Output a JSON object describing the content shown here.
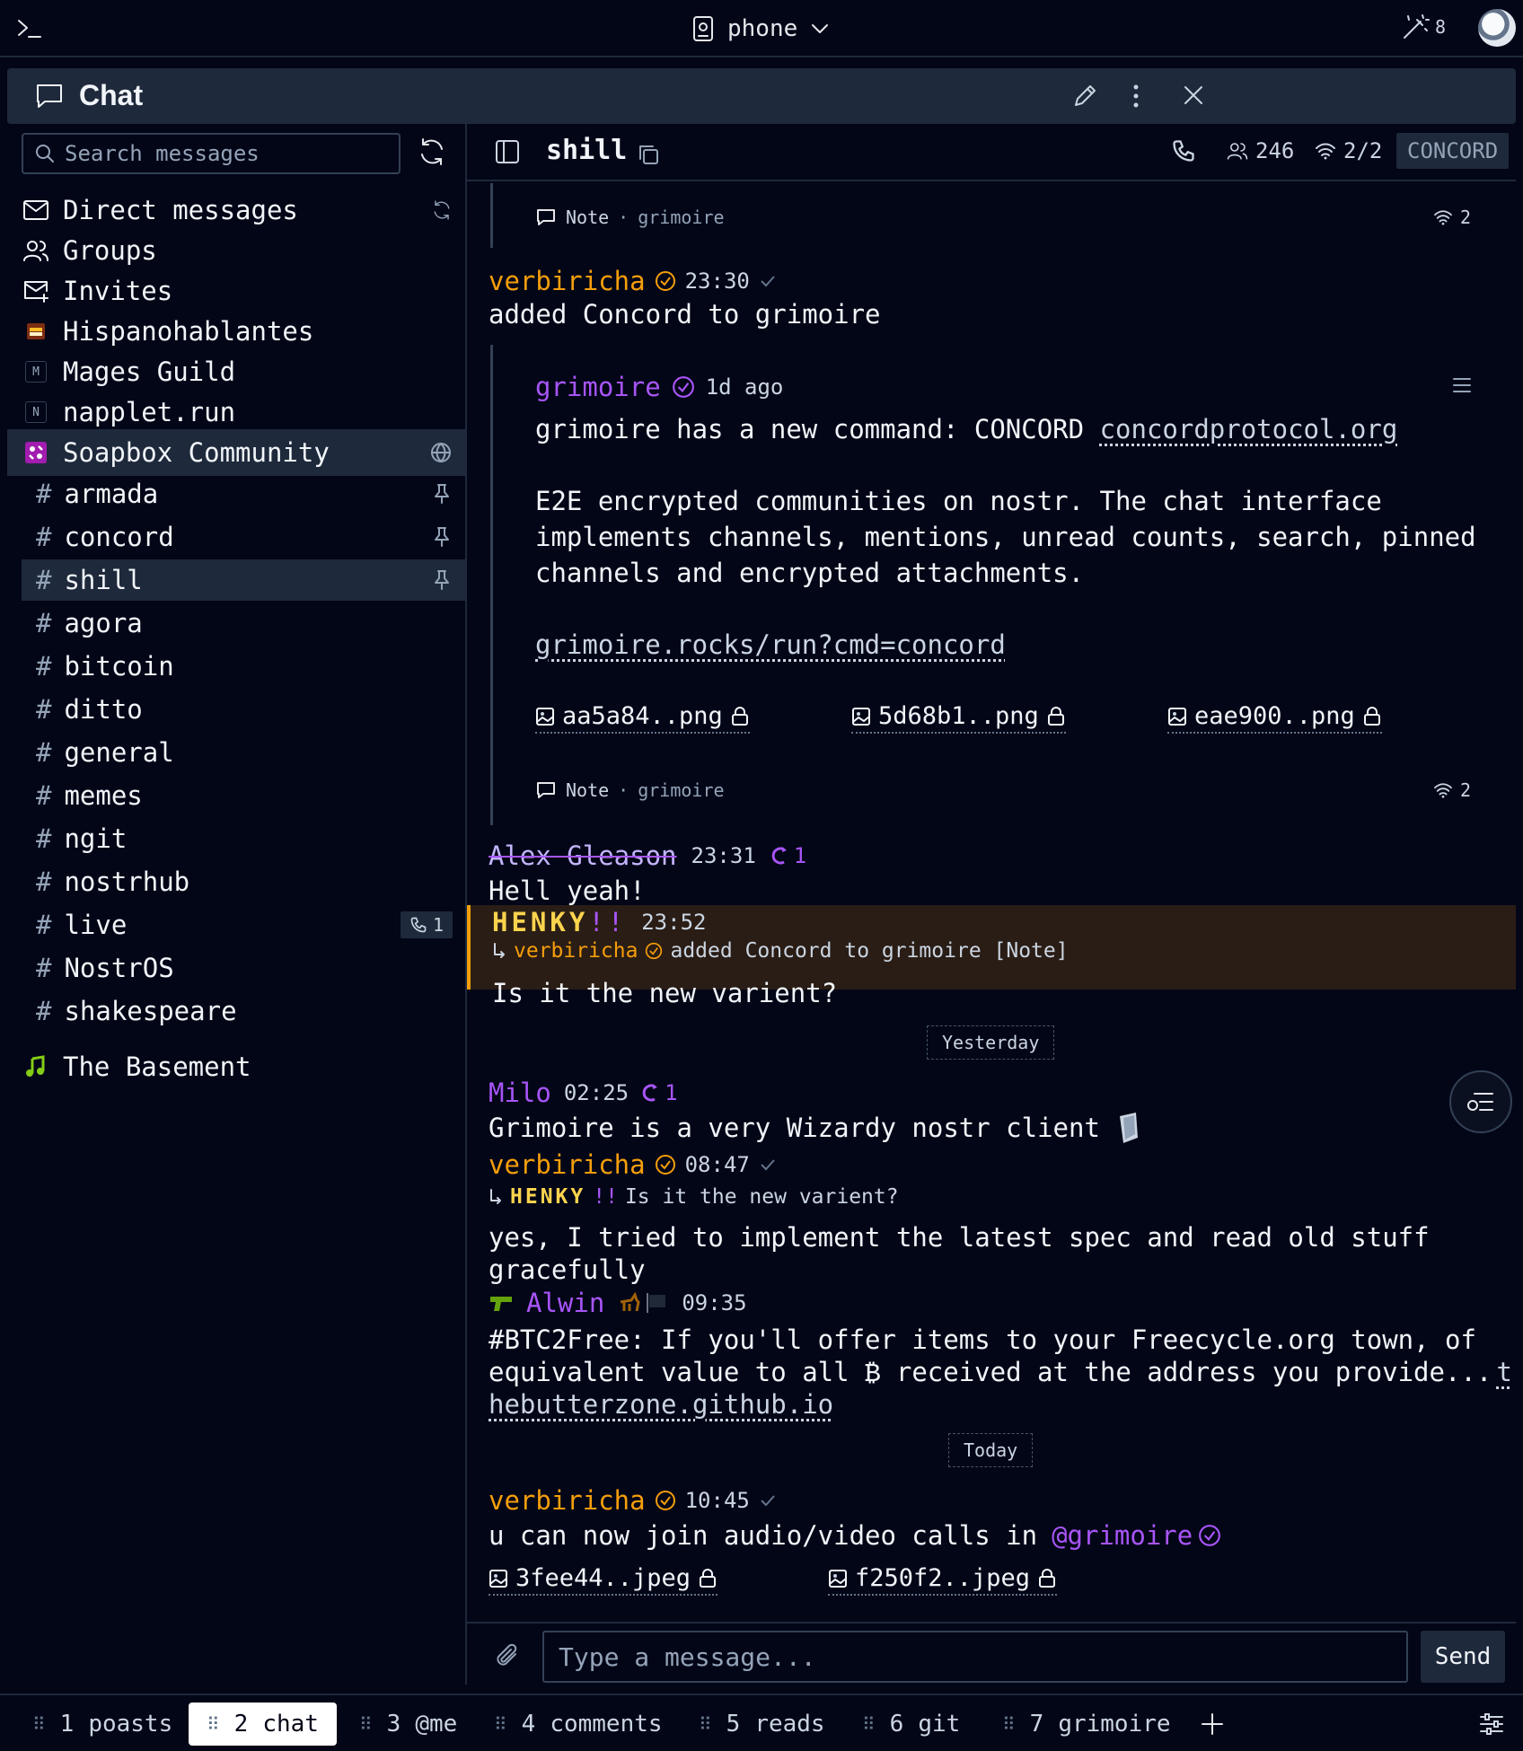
{
  "topbar": {
    "workspace": "phone",
    "wand_count": "8"
  },
  "window": {
    "title": "Chat"
  },
  "sidebar": {
    "search_placeholder": "Search messages",
    "items": [
      {
        "label": "Direct messages"
      },
      {
        "label": "Groups"
      },
      {
        "label": "Invites"
      },
      {
        "label": "Hispanohablantes"
      },
      {
        "label": "Mages Guild",
        "letter": "M"
      },
      {
        "label": "napplet.run",
        "letter": "N"
      },
      {
        "label": "Soapbox Community"
      }
    ],
    "channels": [
      "armada",
      "concord",
      "shill",
      "agora",
      "bitcoin",
      "ditto",
      "general",
      "memes",
      "ngit",
      "nostrhub",
      "live",
      "NostrOS",
      "shakespeare"
    ],
    "channel_hash": "#",
    "live_calls": "1",
    "basement": "The Basement"
  },
  "chat_header": {
    "channel": "shill",
    "members": "246",
    "relays": "2/2",
    "protocol": "CONCORD"
  },
  "messages": {
    "top_note": {
      "kind": "Note",
      "sep": "·",
      "source": "grimoire",
      "relays": "2"
    },
    "m1": {
      "author": "verbiricha",
      "time": "23:30",
      "text": "added Concord to grimoire"
    },
    "quote": {
      "author": "grimoire",
      "time": "1d ago",
      "line1": "grimoire has a new command: CONCORD",
      "line1_link": "concordprotocol.org",
      "para1": "E2E encrypted communities on nostr. The chat interface",
      "para2": "implements channels, mentions, unread counts, search, pinned",
      "para3": "channels and encrypted attachments.",
      "link2": "grimoire.rocks/run?cmd=concord",
      "files": [
        "aa5a84..png",
        "5d68b1..png",
        "eae900..png"
      ],
      "note_kind": "Note",
      "sep": "·",
      "note_source": "grimoire",
      "relays": "2"
    },
    "m2": {
      "author": "Alex Gleason",
      "time": "23:31",
      "boosts": "1",
      "text": "Hell yeah!"
    },
    "m3": {
      "author": "HENKY",
      "author_suffix": "!!",
      "time": "23:52",
      "reply_author": "verbiricha",
      "reply_text": "added Concord to grimoire [Note]",
      "text": "Is it the new varient?"
    },
    "day1": "Yesterday",
    "m4": {
      "author": "Milo",
      "time": "02:25",
      "boosts": "1",
      "text": "Grimoire is a very Wizardy nostr client"
    },
    "m5": {
      "author": "verbiricha",
      "time": "08:47",
      "reply_author": "HENKY",
      "reply_suffix": "!!",
      "reply_text": "Is it the new varient?",
      "line1": "yes, I tried to implement the latest spec and read old stuff",
      "line2": "gracefully"
    },
    "m6": {
      "author": "Alwin",
      "time": "09:35",
      "line1": "#BTC2Free: If you'll offer items to your Freecycle.org town, of",
      "line2": "equivalent value to all ₿ received at the address you provide...",
      "link_a": "t",
      "link_b": "hebutterzone.github.io"
    },
    "day2": "Today",
    "m7": {
      "author": "verbiricha",
      "time": "10:45",
      "text": "u can now join audio/video calls in",
      "mention": "@grimoire",
      "files": [
        "3fee44..jpeg",
        "f250f2..jpeg"
      ]
    }
  },
  "composer": {
    "placeholder": "Type a message...",
    "send": "Send"
  },
  "tabs": [
    {
      "num": "1",
      "label": "poasts"
    },
    {
      "num": "2",
      "label": "chat"
    },
    {
      "num": "3",
      "label": "@me"
    },
    {
      "num": "4",
      "label": "comments"
    },
    {
      "num": "5",
      "label": "reads"
    },
    {
      "num": "6",
      "label": "git"
    },
    {
      "num": "7",
      "label": "grimoire"
    }
  ],
  "tab_grip": "⠿",
  "colors": {
    "accent_orange": "#f59e0b",
    "accent_purple": "#a855f7",
    "bg": "#020617",
    "panel": "#1e293b"
  }
}
